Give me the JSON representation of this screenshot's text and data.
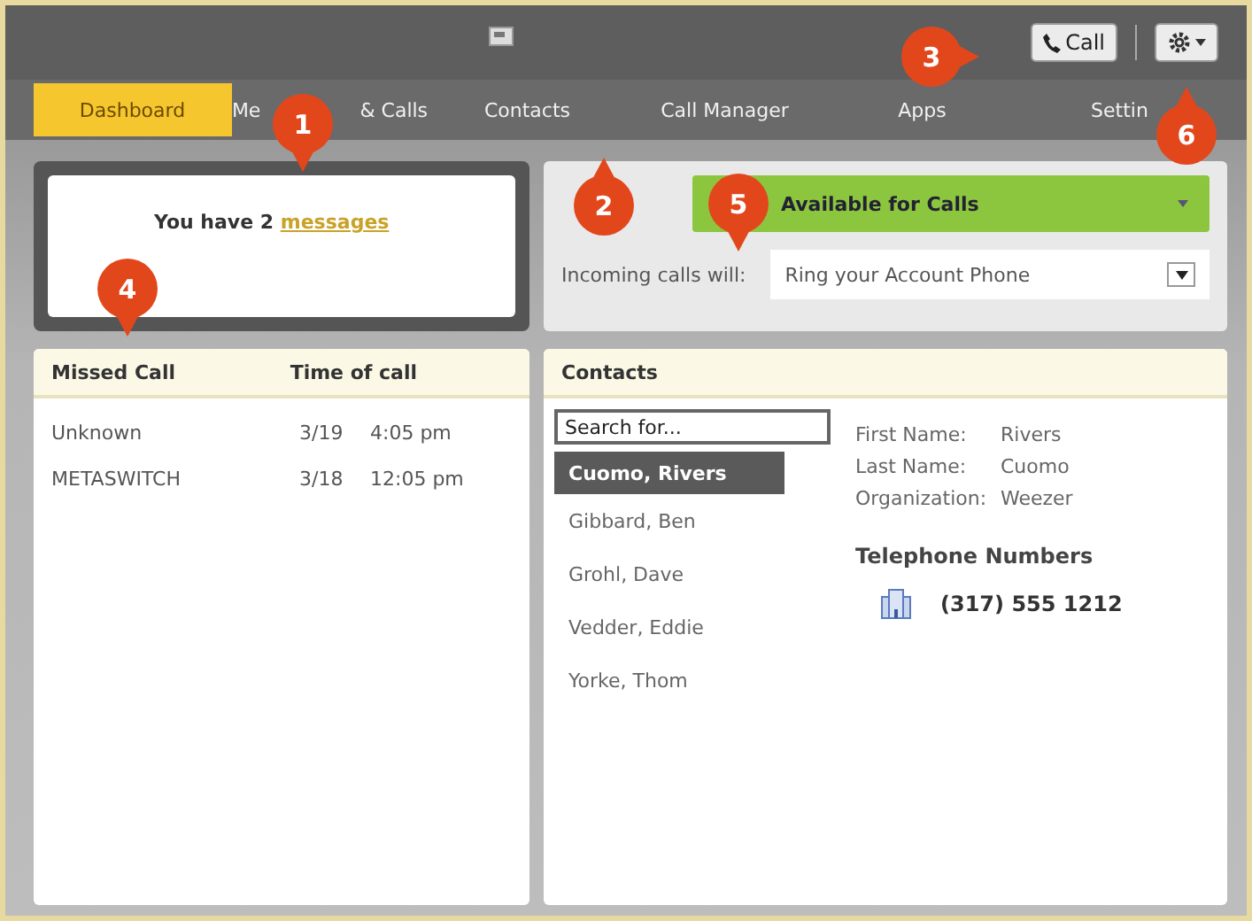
{
  "toolbar": {
    "call_button": "Call"
  },
  "tabs": [
    {
      "label_parts": [
        "Dashboard"
      ],
      "selected": true
    },
    {
      "label_parts": [
        "Me",
        "& Calls"
      ],
      "selected": false
    },
    {
      "label_parts": [
        "Contacts"
      ],
      "selected": false
    },
    {
      "label_parts": [
        "Call Manager"
      ],
      "selected": false
    },
    {
      "label_parts": [
        "Apps"
      ],
      "selected": false
    },
    {
      "label_parts": [
        "Settin"
      ],
      "selected": false
    }
  ],
  "messages": {
    "text": "You have 2 ",
    "link": "messages"
  },
  "missed_calls": {
    "columns": [
      "Missed Call",
      "Time of call"
    ],
    "rows": [
      {
        "caller": "Unknown",
        "date": "3/19",
        "time": "4:05 pm"
      },
      {
        "caller": "METASWITCH",
        "date": "3/18",
        "time": "12:05 pm"
      }
    ]
  },
  "status": {
    "label": "Available for Calls",
    "incoming_label": "Incoming calls will:",
    "incoming_value": "Ring your Account Phone"
  },
  "contacts": {
    "title": "Contacts",
    "search_placeholder": "Search for...",
    "list": [
      {
        "name": "Cuomo, Rivers",
        "selected": true
      },
      {
        "name": "Gibbard, Ben",
        "selected": false
      },
      {
        "name": "Grohl, Dave",
        "selected": false
      },
      {
        "name": "Vedder, Eddie",
        "selected": false
      },
      {
        "name": "Yorke, Thom",
        "selected": false
      }
    ],
    "details": [
      {
        "label": "First Name:",
        "value": "Rivers"
      },
      {
        "label": "Last Name:",
        "value": "Cuomo"
      },
      {
        "label": "Organization:",
        "value": "Weezer"
      }
    ],
    "phones_title": "Telephone Numbers",
    "phones": [
      "(317) 555 1212"
    ]
  },
  "callouts": [
    {
      "number": "1",
      "kind": "down"
    },
    {
      "number": "2",
      "kind": "up"
    },
    {
      "number": "3",
      "kind": "right"
    },
    {
      "number": "4",
      "kind": "down"
    },
    {
      "number": "5",
      "kind": "down"
    },
    {
      "number": "6",
      "kind": "up"
    }
  ]
}
